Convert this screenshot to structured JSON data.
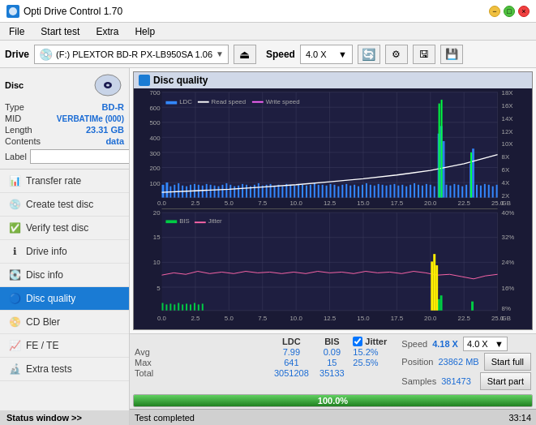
{
  "titlebar": {
    "title": "Opti Drive Control 1.70",
    "icon_label": "ODC"
  },
  "menubar": {
    "items": [
      "File",
      "Start test",
      "Extra",
      "Help"
    ]
  },
  "drivebar": {
    "drive_label": "Drive",
    "drive_name": "(F:) PLEXTOR BD-R  PX-LB950SA 1.06",
    "speed_label": "Speed",
    "speed_value": "4.0 X"
  },
  "disc": {
    "title": "Disc",
    "type_label": "Type",
    "type_value": "BD-R",
    "mid_label": "MID",
    "mid_value": "VERBATIMe (000)",
    "length_label": "Length",
    "length_value": "23.31 GB",
    "contents_label": "Contents",
    "contents_value": "data",
    "label_label": "Label",
    "label_placeholder": ""
  },
  "nav": {
    "items": [
      {
        "id": "transfer-rate",
        "label": "Transfer rate",
        "icon": "📊"
      },
      {
        "id": "create-test-disc",
        "label": "Create test disc",
        "icon": "💿"
      },
      {
        "id": "verify-test-disc",
        "label": "Verify test disc",
        "icon": "✅"
      },
      {
        "id": "drive-info",
        "label": "Drive info",
        "icon": "ℹ"
      },
      {
        "id": "disc-info",
        "label": "Disc info",
        "icon": "💽"
      },
      {
        "id": "disc-quality",
        "label": "Disc quality",
        "icon": "🔵",
        "active": true
      },
      {
        "id": "cd-bler",
        "label": "CD Bler",
        "icon": "📀"
      },
      {
        "id": "fe-te",
        "label": "FE / TE",
        "icon": "📈"
      },
      {
        "id": "extra-tests",
        "label": "Extra tests",
        "icon": "🔬"
      }
    ],
    "status_window": "Status window >>"
  },
  "chart": {
    "title": "Disc quality",
    "legend_ldc": "LDC",
    "legend_read": "Read speed",
    "legend_write": "Write speed",
    "legend_bis": "BIS",
    "legend_jitter": "Jitter",
    "x_labels": [
      "0.0",
      "2.5",
      "5.0",
      "7.5",
      "10.0",
      "12.5",
      "15.0",
      "17.5",
      "20.0",
      "22.5",
      "25.0"
    ],
    "y_left_top": [
      "700",
      "600",
      "500",
      "400",
      "300",
      "200",
      "100"
    ],
    "y_right_top": [
      "18X",
      "16X",
      "14X",
      "12X",
      "10X",
      "8X",
      "6X",
      "4X",
      "2X"
    ],
    "y_left_bottom": [
      "20",
      "15",
      "10",
      "5"
    ],
    "y_right_bottom": [
      "40%",
      "32%",
      "24%",
      "16%",
      "8%"
    ],
    "x_label_suffix": "GB"
  },
  "stats": {
    "col_ldc": "LDC",
    "col_bis": "BIS",
    "col_jitter_label": "Jitter",
    "col_speed": "Speed",
    "col_speed_val": "4.18 X",
    "col_speed_select": "4.0 X",
    "jitter_checked": true,
    "avg_label": "Avg",
    "avg_ldc": "7.99",
    "avg_bis": "0.09",
    "avg_jitter": "15.2%",
    "max_label": "Max",
    "max_ldc": "641",
    "max_bis": "15",
    "max_jitter": "25.5%",
    "position_label": "Position",
    "position_val": "23862 MB",
    "total_label": "Total",
    "total_ldc": "3051208",
    "total_bis": "35133",
    "samples_label": "Samples",
    "samples_val": "381473",
    "start_full": "Start full",
    "start_part": "Start part"
  },
  "progressbar": {
    "percent": 100,
    "percent_text": "100.0%"
  },
  "statusbar": {
    "text": "Test completed",
    "time": "33:14"
  }
}
